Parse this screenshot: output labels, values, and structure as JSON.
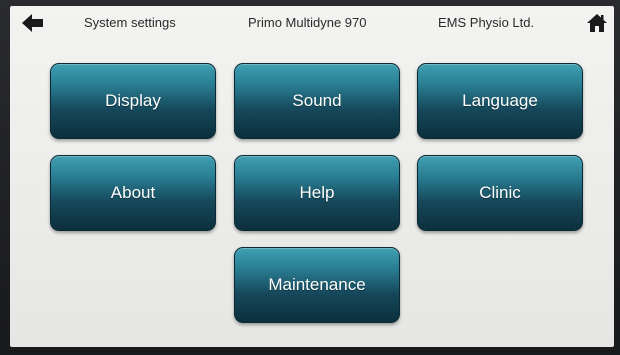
{
  "header": {
    "back_icon": "arrow-left-icon",
    "section_title": "System settings",
    "device_model": "Primo Multidyne 970",
    "company": "EMS Physio Ltd.",
    "home_icon": "home-icon"
  },
  "menu": {
    "display": "Display",
    "sound": "Sound",
    "language": "Language",
    "about": "About",
    "help": "Help",
    "clinic": "Clinic",
    "maintenance": "Maintenance"
  },
  "colors": {
    "tile_top": "#3fa0b2",
    "tile_bottom": "#0c2f3d",
    "screen_bg": "#efefed",
    "text_dark": "#2b2b2b"
  }
}
